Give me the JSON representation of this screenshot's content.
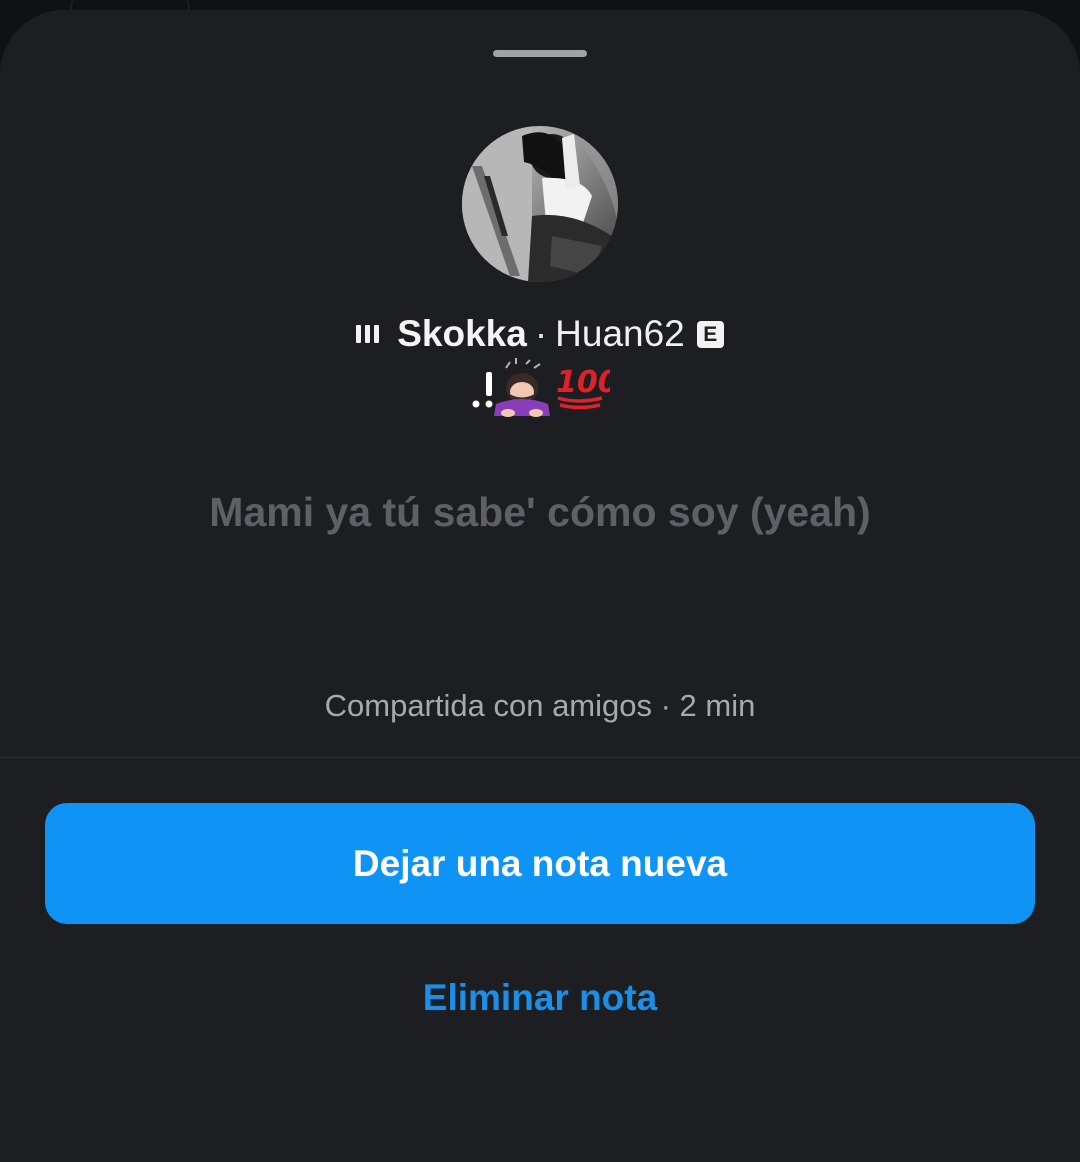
{
  "note": {
    "song_title": "Skokka",
    "song_separator": "·",
    "song_artist": "Huan62",
    "explicit_badge": "E",
    "emoji_status": [
      ".!",
      "person-bowing-emoji",
      "hundred-points-emoji"
    ],
    "text": "Mami ya tú sabe' cómo soy (yeah)",
    "meta": "Compartida con amigos · 2 min"
  },
  "actions": {
    "primary_label": "Dejar una nota nueva",
    "delete_label": "Eliminar nota"
  },
  "colors": {
    "sheet_background": "#1d1e22",
    "primary_button": "#0f93f5",
    "link": "#1b8fe8",
    "note_text": "#5e6066",
    "meta_text": "#a7a9ae"
  }
}
